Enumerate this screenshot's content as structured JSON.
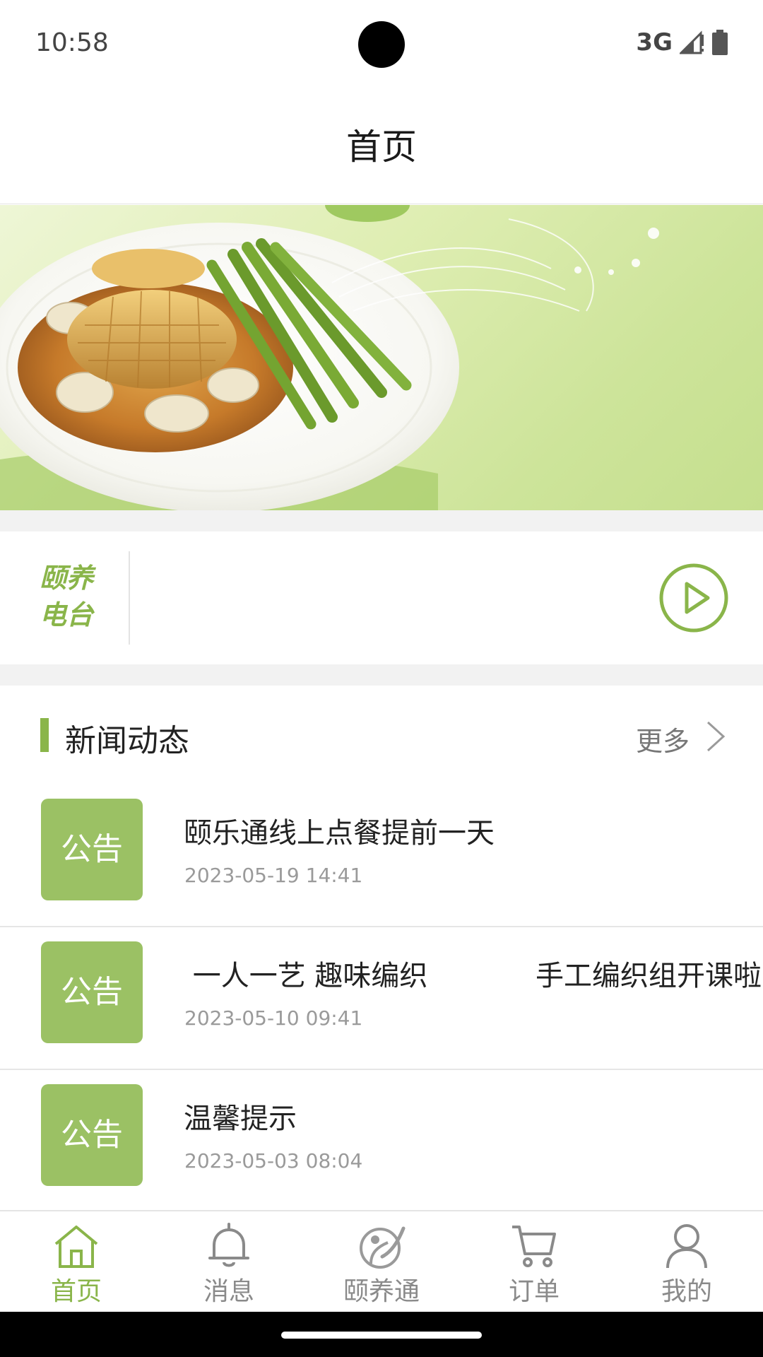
{
  "status_bar": {
    "time": "10:58",
    "network": "3G"
  },
  "app_bar": {
    "title": "首页"
  },
  "radio": {
    "label_line1": "颐养",
    "label_line2": "电台",
    "play_icon": "play-circle-icon"
  },
  "news": {
    "title": "新闻动态",
    "more_label": "更多",
    "items": [
      {
        "badge": "公告",
        "title": "颐乐通线上点餐提前一天",
        "date": "2023-05-19 14:41"
      },
      {
        "badge": "公告",
        "title": " 一人一艺 趣味编织            手工编织组开课啦",
        "date": "2023-05-10 09:41"
      },
      {
        "badge": "公告",
        "title": "温馨提示",
        "date": "2023-05-03 08:04"
      }
    ]
  },
  "bottom_nav": {
    "items": [
      {
        "label": "首页",
        "icon": "home-icon",
        "active": true
      },
      {
        "label": "消息",
        "icon": "bell-icon",
        "active": false
      },
      {
        "label": "颐养通",
        "icon": "yiyangtong-icon",
        "active": false
      },
      {
        "label": "订单",
        "icon": "cart-icon",
        "active": false
      },
      {
        "label": "我的",
        "icon": "person-icon",
        "active": false
      }
    ]
  },
  "colors": {
    "accent": "#8ab54a",
    "badge": "#9bc164",
    "inactive": "#8a8a8a"
  }
}
